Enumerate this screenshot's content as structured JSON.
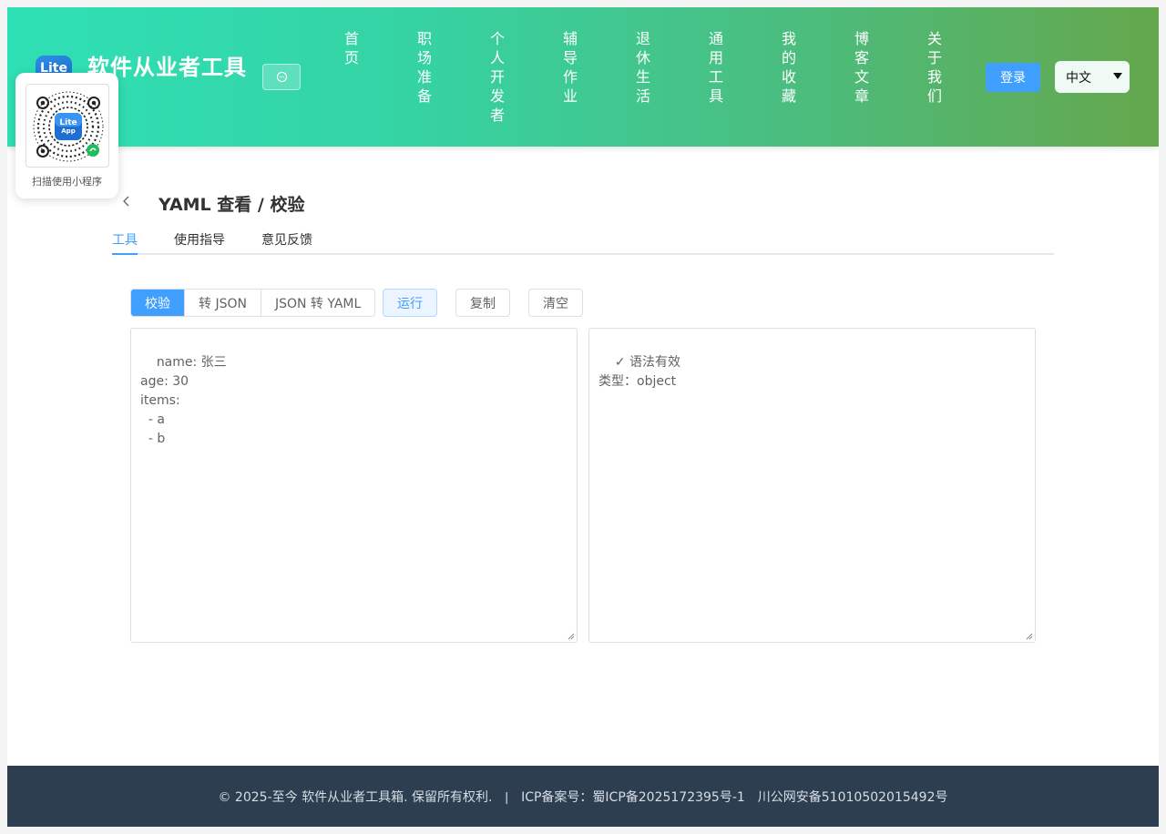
{
  "header": {
    "logo_text": "Lite",
    "brand": "软件从业者工具",
    "nav": [
      "首页",
      "职场准备",
      "个人开发者",
      "辅导作业",
      "退休生活",
      "通用工具",
      "我的收藏",
      "博客文章",
      "关于我们"
    ],
    "login_label": "登录",
    "language": "中文"
  },
  "qr": {
    "caption": "扫描使用小程序",
    "app_line1": "Lite",
    "app_line2": "App"
  },
  "page": {
    "title": "YAML 查看 / 校验",
    "tabs": [
      "工具",
      "使用指导",
      "意见反馈"
    ],
    "active_tab": 0
  },
  "toolbar": {
    "modes": [
      "校验",
      "转 JSON",
      "JSON 转 YAML"
    ],
    "active_mode": 0,
    "run_label": "运行",
    "copy_label": "复制",
    "clear_label": "清空"
  },
  "editor": {
    "input": "name: 张三\nage: 30\nitems:\n  - a\n  - b",
    "output": "✓ 语法有效\n类型：object"
  },
  "footer": {
    "copyright": "© 2025-至今 软件从业者工具箱. 保留所有权利.",
    "separator": "|",
    "icp": "ICP备案号：蜀ICP备2025172395号-1",
    "police": "川公网安备51010502015492号"
  },
  "colors": {
    "primary": "#409eff",
    "header_gradient_start": "#2ee0b5",
    "header_gradient_end": "#65a74c",
    "footer_bg": "#2d3e50"
  }
}
